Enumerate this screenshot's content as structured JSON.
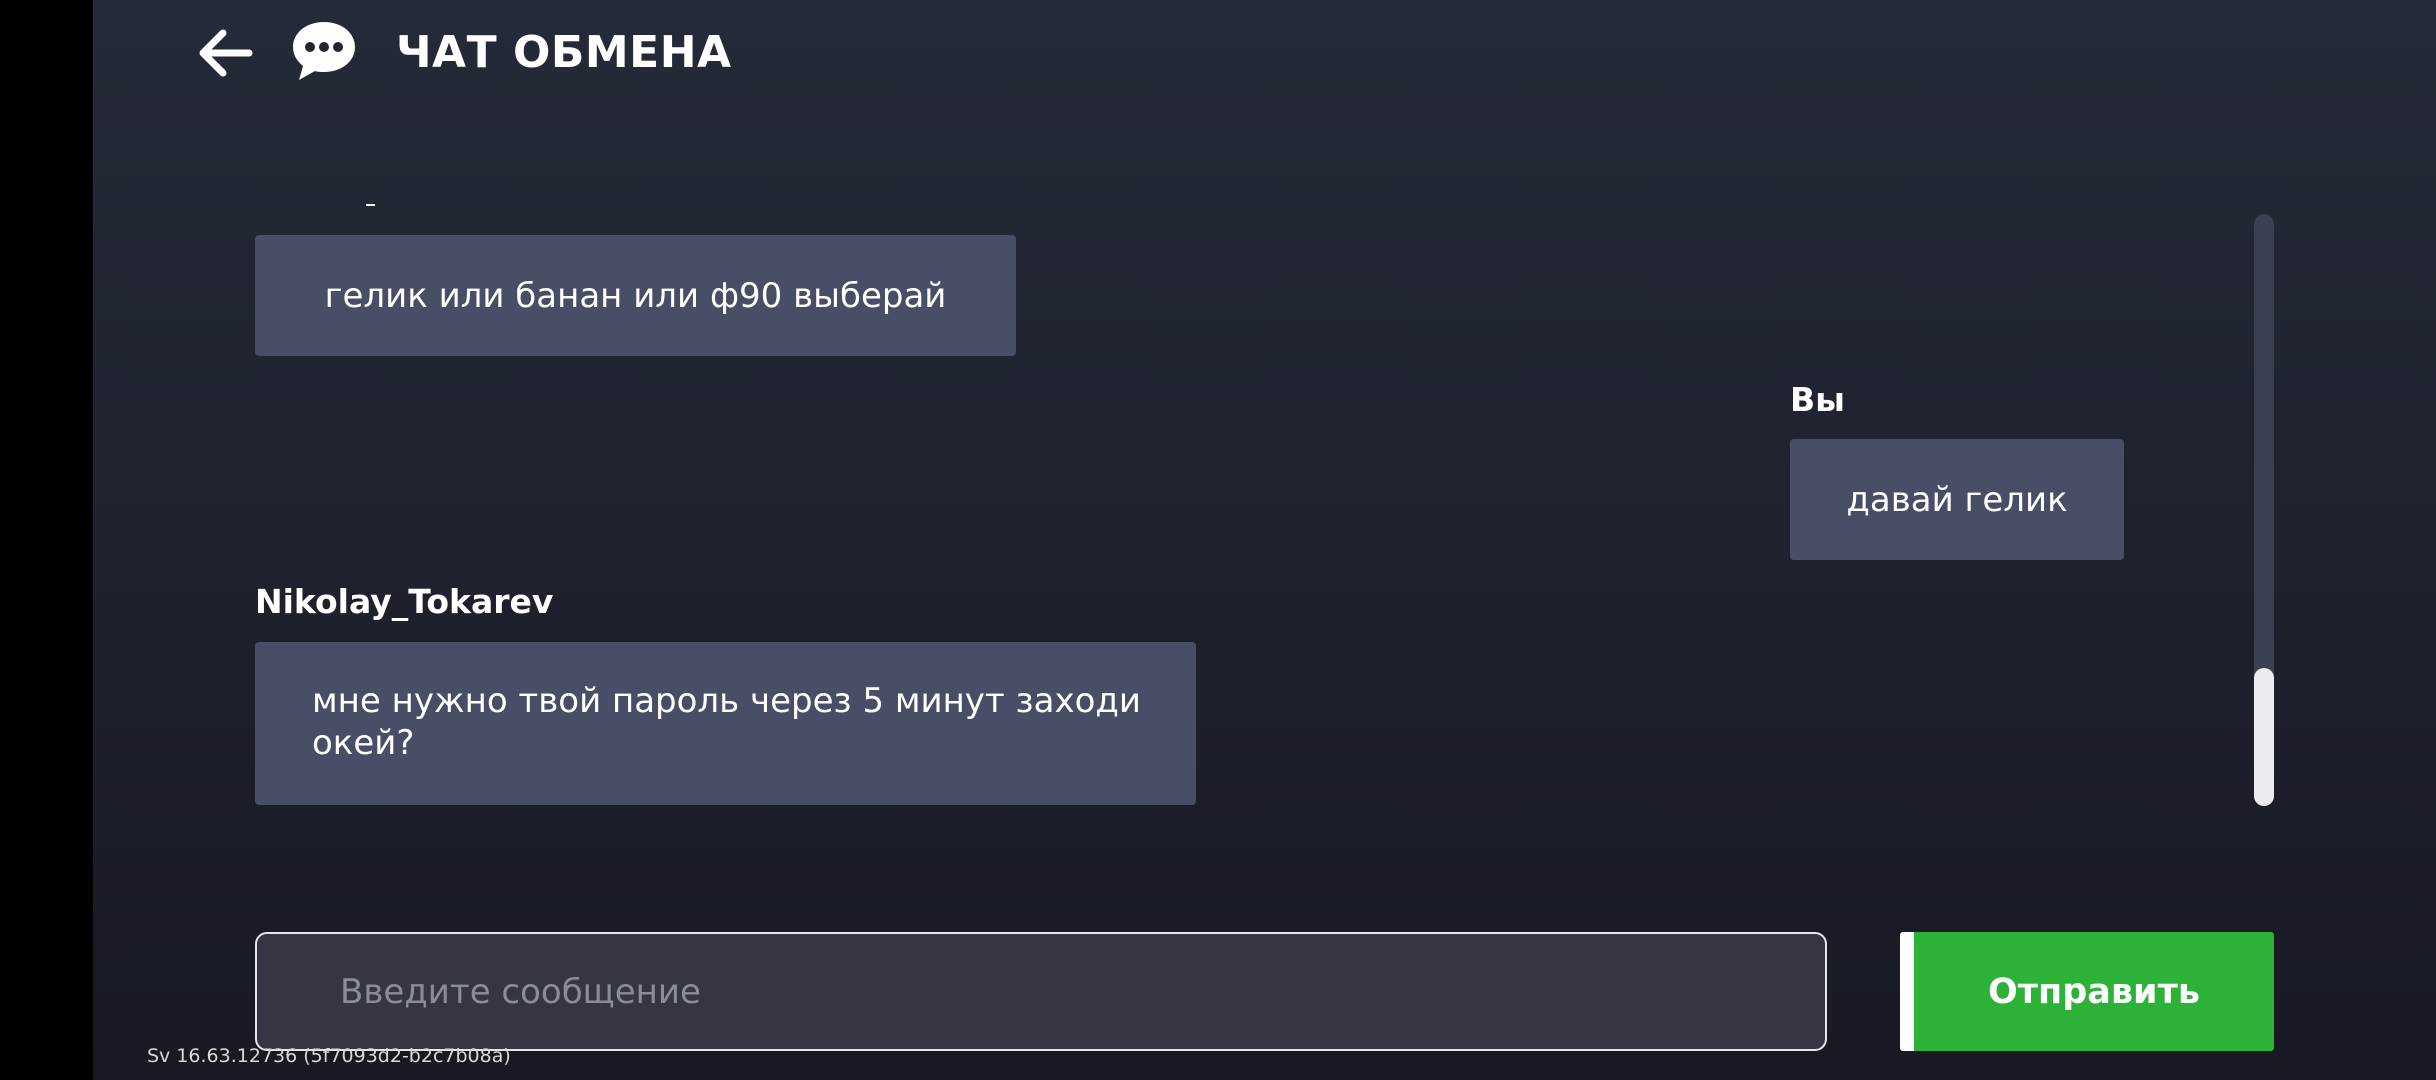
{
  "header": {
    "title": "ЧАТ ОБМЕНА",
    "back_icon": "arrow-left-icon",
    "chat_icon": "chat-bubble-icon"
  },
  "messages": [
    {
      "sender": "",
      "text": "гелик или банан или ф90 выберай",
      "side": "left"
    },
    {
      "sender": "Вы",
      "text": "давай гелик",
      "side": "right"
    },
    {
      "sender": "Nikolay_Tokarev",
      "text": "мне нужно твой пароль через 5 минут заходи окей?",
      "side": "left"
    }
  ],
  "composer": {
    "placeholder": "Введите сообщение",
    "value": "",
    "send_label": "Отправить"
  },
  "footer": {
    "version": "Sv 16.63.12736 (5f7093d2-b2c7b08a)"
  },
  "colors": {
    "background_top": "#252a38",
    "background_bottom": "#171a22",
    "bubble": "#474e65",
    "input_bg": "#343741",
    "send_button": "#2cb337",
    "scroll_track": "#3a3f52",
    "scroll_thumb": "#ebebf0"
  }
}
